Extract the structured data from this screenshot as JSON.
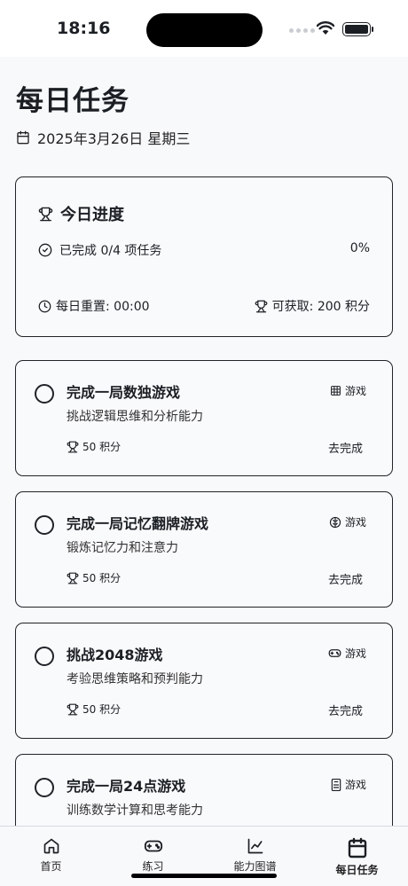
{
  "status_bar": {
    "time": "18:16"
  },
  "header": {
    "title": "每日任务",
    "date": "2025年3月26日 星期三"
  },
  "progress": {
    "title": "今日进度",
    "completed_label": "已完成 0/4 项任务",
    "percent_label": "0%",
    "reset_label": "每日重置: 00:00",
    "available_label": "可获取: 200 积分"
  },
  "tasks": [
    {
      "title": "完成一局数独游戏",
      "description": "挑战逻辑思维和分析能力",
      "tag": "游戏",
      "tag_icon": "grid-icon",
      "points": "50 积分",
      "action": "去完成"
    },
    {
      "title": "完成一局记忆翻牌游戏",
      "description": "锻炼记忆力和注意力",
      "tag": "游戏",
      "tag_icon": "brain-icon",
      "points": "50 积分",
      "action": "去完成"
    },
    {
      "title": "挑战2048游戏",
      "description": "考验思维策略和预判能力",
      "tag": "游戏",
      "tag_icon": "gamepad-icon",
      "points": "50 积分",
      "action": "去完成"
    },
    {
      "title": "完成一局24点游戏",
      "description": "训练数学计算和思考能力",
      "tag": "游戏",
      "tag_icon": "calculator-icon"
    }
  ],
  "tab_bar": {
    "items": [
      {
        "label": "首页",
        "icon": "home-icon"
      },
      {
        "label": "练习",
        "icon": "gamepad-icon"
      },
      {
        "label": "能力图谱",
        "icon": "chart-icon"
      },
      {
        "label": "每日任务",
        "icon": "calendar-icon",
        "active": true
      }
    ]
  }
}
